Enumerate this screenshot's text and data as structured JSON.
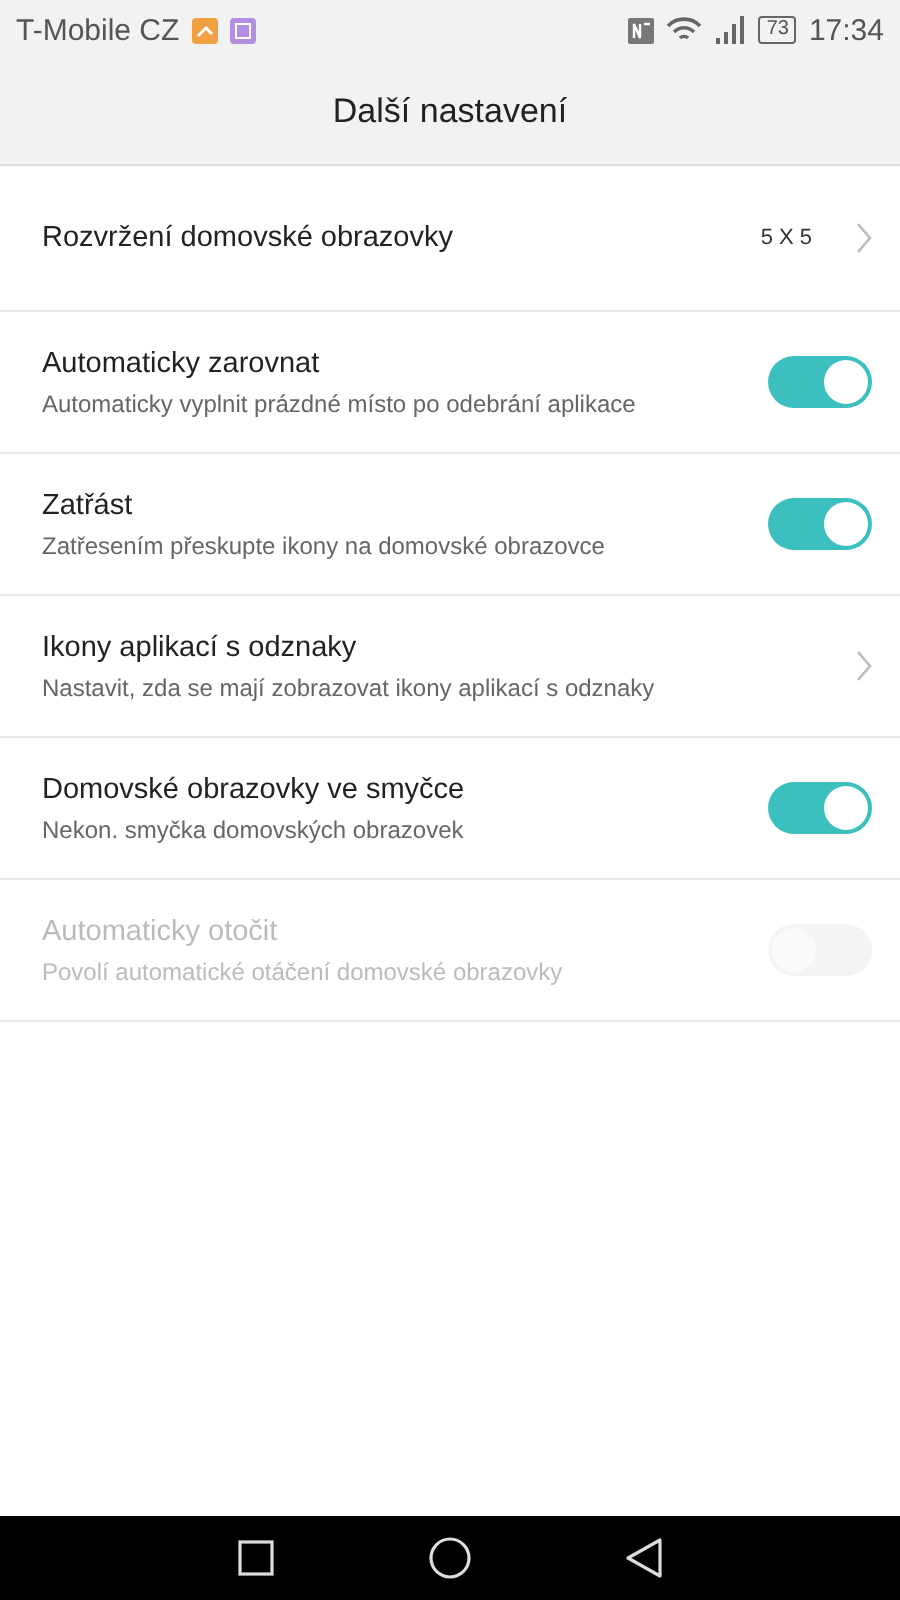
{
  "status_bar": {
    "carrier": "T-Mobile CZ",
    "battery": "73",
    "time": "17:34"
  },
  "header": {
    "title": "Další nastavení"
  },
  "settings": [
    {
      "kind": "link",
      "title": "Rozvržení domovské obrazovky",
      "value": "5 X 5",
      "disabled": false
    },
    {
      "kind": "toggle",
      "title": "Automaticky zarovnat",
      "subtitle": "Automaticky vyplnit prázdné místo po odebrání aplikace",
      "on": true,
      "disabled": false
    },
    {
      "kind": "toggle",
      "title": "Zatřást",
      "subtitle": "Zatřesením přeskupte ikony na domovské obrazovce",
      "on": true,
      "disabled": false
    },
    {
      "kind": "link",
      "title": "Ikony aplikací s odznaky",
      "subtitle": "Nastavit, zda se mají zobrazovat ikony aplikací s odznaky",
      "disabled": false
    },
    {
      "kind": "toggle",
      "title": "Domovské obrazovky ve smyčce",
      "subtitle": "Nekon. smyčka domovských obrazovek",
      "on": true,
      "disabled": false
    },
    {
      "kind": "toggle",
      "title": "Automaticky otočit",
      "subtitle": "Povolí automatické otáčení domovské obrazovky",
      "on": false,
      "disabled": true
    }
  ]
}
